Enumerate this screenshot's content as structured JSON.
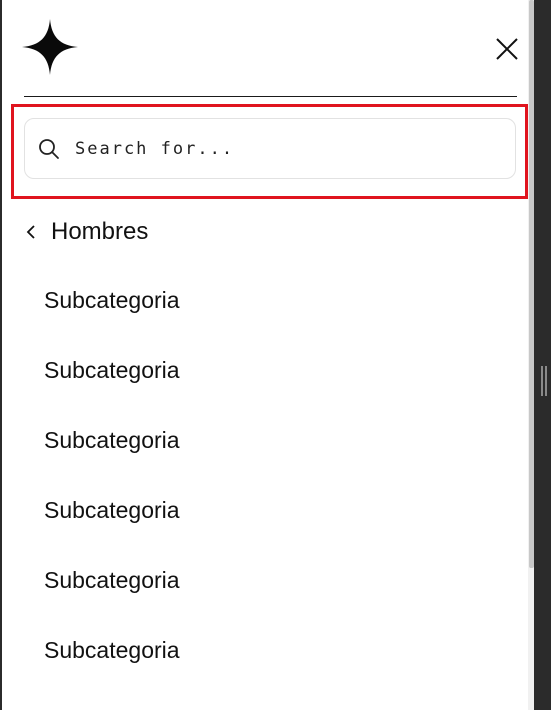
{
  "header": {
    "logo_icon": "four-point-star-icon",
    "close_icon": "close-icon"
  },
  "search": {
    "placeholder": "Search for...",
    "value": "",
    "icon": "search-icon",
    "highlight_color": "#e0141e"
  },
  "nav": {
    "back_label": "Hombres",
    "back_icon": "chevron-left-icon",
    "items": [
      {
        "label": "Subcategoria"
      },
      {
        "label": "Subcategoria"
      },
      {
        "label": "Subcategoria"
      },
      {
        "label": "Subcategoria"
      },
      {
        "label": "Subcategoria"
      },
      {
        "label": "Subcategoria"
      }
    ]
  }
}
